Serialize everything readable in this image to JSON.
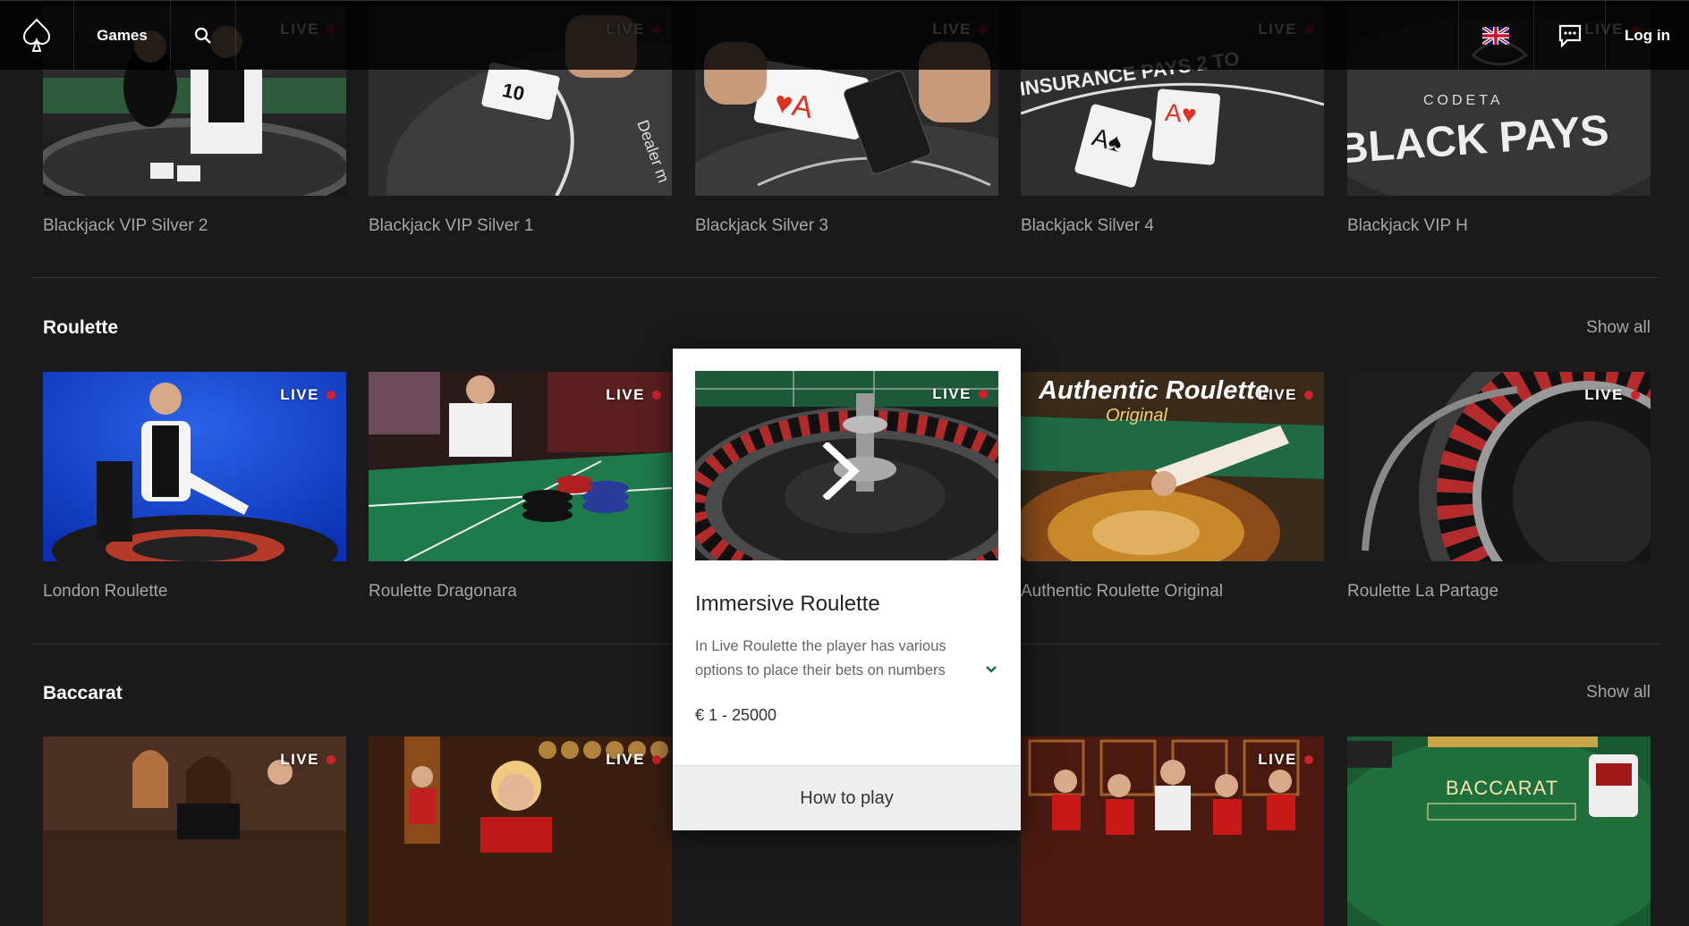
{
  "nav": {
    "games_label": "Games",
    "login_label": "Log in"
  },
  "live_label": "LIVE",
  "blackjack": {
    "items": [
      {
        "name": "Blackjack VIP Silver 2"
      },
      {
        "name": "Blackjack VIP Silver 1"
      },
      {
        "name": "Blackjack Silver 3"
      },
      {
        "name": "Blackjack Silver 4"
      },
      {
        "name": "Blackjack VIP H"
      }
    ]
  },
  "roulette": {
    "title": "Roulette",
    "show_all": "Show all",
    "items": [
      {
        "name": "London Roulette"
      },
      {
        "name": "Roulette Dragonara"
      },
      {
        "name": "Immersive Roulette"
      },
      {
        "name": "Authentic Roulette Original"
      },
      {
        "name": "Roulette La Partage"
      }
    ]
  },
  "baccarat": {
    "title": "Baccarat",
    "show_all": "Show all"
  },
  "popup": {
    "title": "Immersive Roulette",
    "description": "In Live Roulette the player has various options to place their bets on numbers",
    "limits": "€ 1 - 25000",
    "how_to_play": "How to play"
  },
  "thumb_text": {
    "authentic_line1": "Authentic Roulette",
    "authentic_line2": "Original",
    "codeta": "CODETA",
    "black_pays": "BLACK PAYS",
    "insurance": "INSURANCE PAYS 2 TO",
    "dealer": "Dealer m",
    "baccarat": "BACCARAT"
  },
  "colors": {
    "background": "#1a1a1a",
    "live_dot": "#d3202d",
    "card_background": "#ffffff",
    "button_background": "#eeeeee",
    "chevron": "#1f6b3a"
  },
  "icons": [
    "spade-logo-icon",
    "search-icon",
    "uk-flag-icon",
    "chat-icon",
    "chevron-right-icon",
    "chevron-down-icon"
  ]
}
